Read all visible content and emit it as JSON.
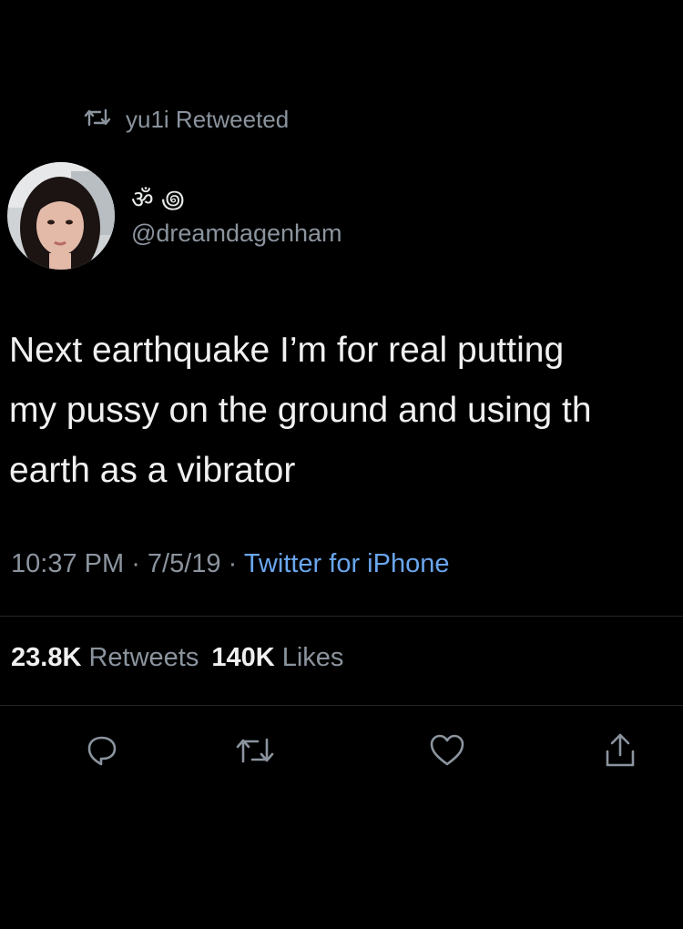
{
  "retweet": {
    "label": "yu1i Retweeted",
    "icon": "retweet-icon"
  },
  "author": {
    "display_name": "ॐ ꩜",
    "handle": "@dreamdagenham"
  },
  "tweet": {
    "line1": "Next earthquake I’m for real putting",
    "line2": "my pussy on the ground and using th",
    "line3": "earth as a vibrator"
  },
  "meta": {
    "time": "10:37 PM",
    "date": "7/5/19",
    "source": "Twitter for iPhone"
  },
  "stats": {
    "retweets_count": "23.8K",
    "retweets_label": "Retweets",
    "likes_count": "140K",
    "likes_label": "Likes"
  },
  "actions": {
    "reply_icon": "reply-icon",
    "retweet_icon": "retweet-icon",
    "like_icon": "heart-icon",
    "share_icon": "share-icon"
  },
  "colors": {
    "background": "#000000",
    "text": "#f0f0f0",
    "secondary": "#8b949e",
    "link": "#6aa6ee",
    "divider": "#232629"
  }
}
